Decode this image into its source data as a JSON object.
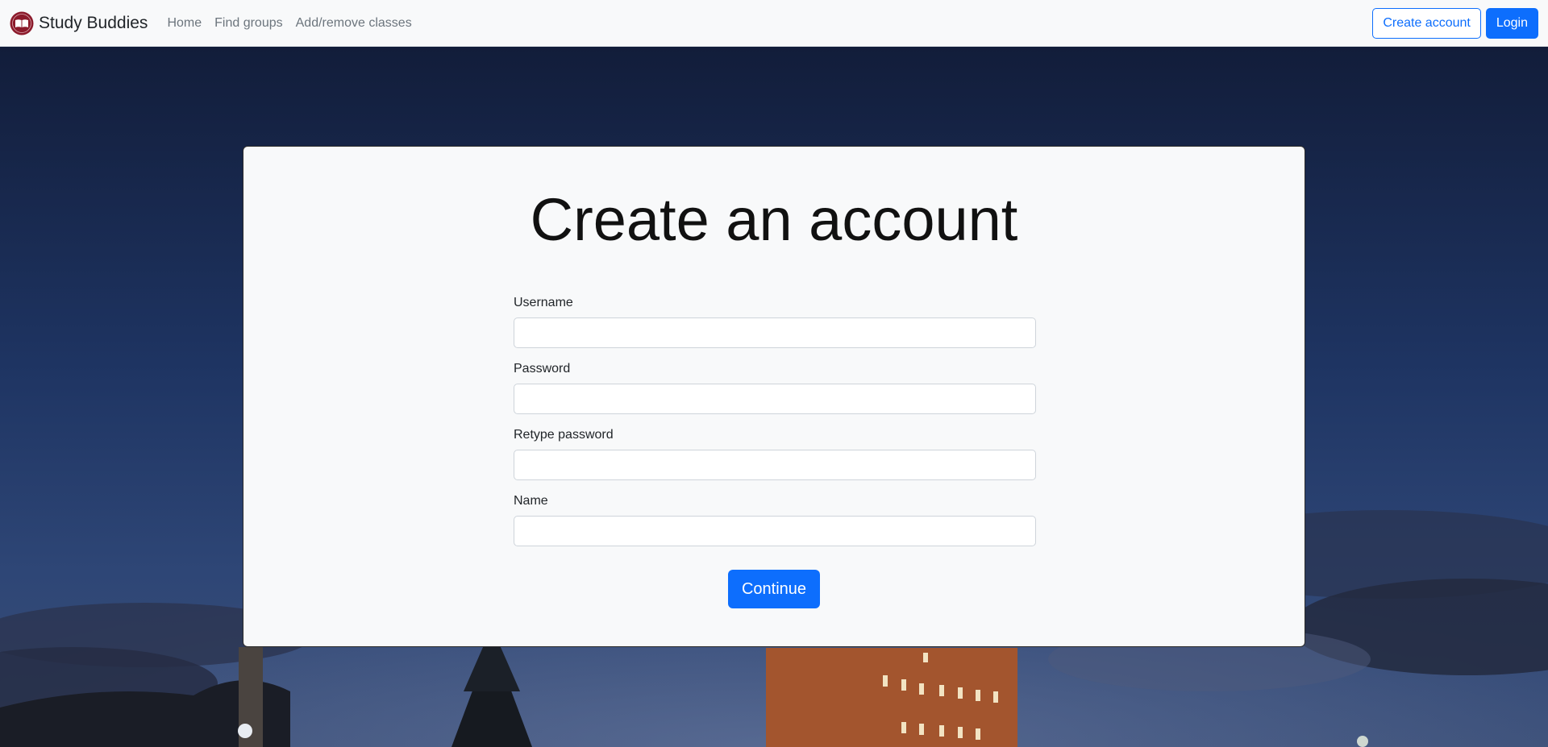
{
  "navbar": {
    "brand": "Study Buddies",
    "links": [
      "Home",
      "Find groups",
      "Add/remove classes"
    ],
    "create_account_label": "Create account",
    "login_label": "Login"
  },
  "card": {
    "title": "Create an account",
    "fields": [
      {
        "label": "Username",
        "value": ""
      },
      {
        "label": "Password",
        "value": ""
      },
      {
        "label": "Retype password",
        "value": ""
      },
      {
        "label": "Name",
        "value": ""
      }
    ],
    "submit_label": "Continue"
  },
  "colors": {
    "primary": "#0d6efd",
    "navbar_bg": "#f8f9fa",
    "card_bg": "#f8f9fa",
    "sky_top": "#121d3a",
    "sky_bottom": "#2e4676",
    "tower": "#a3552e",
    "logo": "#8b1a2b"
  },
  "icons": {
    "brand_logo": "book-seal-icon"
  }
}
